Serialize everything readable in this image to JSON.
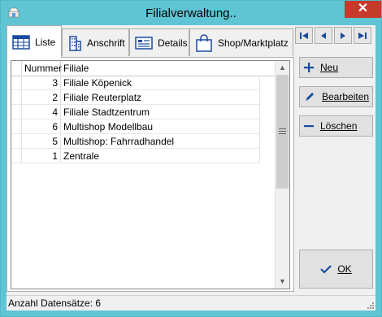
{
  "window": {
    "title": "Filialverwaltung..",
    "close_glyph": "✕"
  },
  "tabs": [
    {
      "label": "Liste",
      "icon": "list-grid-icon"
    },
    {
      "label": "Anschrift",
      "icon": "building-icon"
    },
    {
      "label": "Details",
      "icon": "details-card-icon"
    },
    {
      "label": "Shop/Marktplatz",
      "icon": "shopping-bag-icon"
    }
  ],
  "nav": [
    "first-record-icon",
    "previous-record-icon",
    "next-record-icon",
    "last-record-icon"
  ],
  "table": {
    "columns": [
      "Nummer",
      "Filiale"
    ],
    "rows": [
      {
        "nummer": "3",
        "filiale": "Filiale Köpenick"
      },
      {
        "nummer": "2",
        "filiale": "Filiale Reuterplatz"
      },
      {
        "nummer": "4",
        "filiale": "Filiale Stadtzentrum"
      },
      {
        "nummer": "6",
        "filiale": "Multishop Modellbau"
      },
      {
        "nummer": "5",
        "filiale": "Multishop: Fahrradhandel"
      },
      {
        "nummer": "1",
        "filiale": "Zentrale"
      }
    ]
  },
  "buttons": {
    "new": "Neu",
    "edit": "Bearbeiten",
    "delete": "Löschen",
    "ok": "OK"
  },
  "status": "Anzahl Datensätze: 6",
  "colors": {
    "titlebar": "#5fc4d4",
    "close": "#c7392a",
    "accent": "#1a4aa0"
  }
}
